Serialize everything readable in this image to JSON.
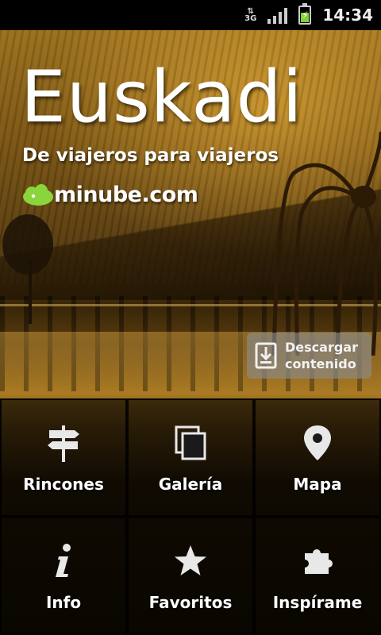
{
  "status_bar": {
    "network": "3G",
    "time": "14:34"
  },
  "hero": {
    "title": "Euskadi",
    "subtitle": "De viajeros para viajeros",
    "brand": "minube.com"
  },
  "download": {
    "label": "Descargar\ncontenido",
    "icon": "download-icon"
  },
  "menu": [
    {
      "label": "Rincones",
      "icon": "signpost-icon"
    },
    {
      "label": "Galería",
      "icon": "gallery-icon"
    },
    {
      "label": "Mapa",
      "icon": "map-pin-icon"
    },
    {
      "label": "Info",
      "icon": "info-icon"
    },
    {
      "label": "Favoritos",
      "icon": "star-icon"
    },
    {
      "label": "Inspírame",
      "icon": "puzzle-icon"
    }
  ],
  "colors": {
    "brand_green": "#8bd53c",
    "tile_bg": "#000000"
  }
}
